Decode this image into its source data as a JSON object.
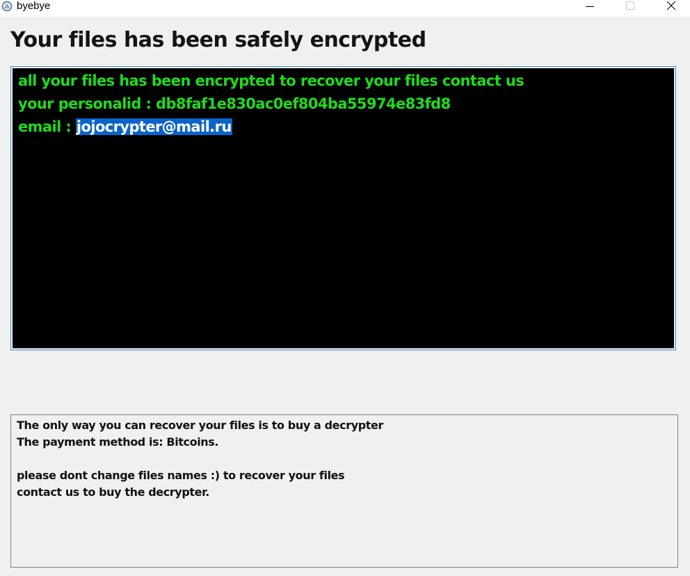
{
  "window": {
    "title": "byebye",
    "icon": "app-icon",
    "controls": {
      "minimize_icon": "minimize-icon",
      "maximize_icon": "maximize-icon",
      "close_icon": "close-icon"
    }
  },
  "heading": "Your files has been safely encrypted",
  "terminal": {
    "line1": "all your files has been encrypted to recover your files contact us",
    "line2": "your personalid : db8faf1e830ac0ef804ba55974e83fd8",
    "line3_label": "email : ",
    "line3_email": "jojocrypter@mail.ru",
    "text_color": "#1ddc1d",
    "background": "#000000",
    "selection_color": "#0a63c8"
  },
  "notes": {
    "line1": "The only way you can recover your files is to buy a decrypter",
    "line2": "The payment method is: Bitcoins.",
    "line3": "please dont change files names :) to recover your files",
    "line4": "contact us to buy the decrypter."
  }
}
